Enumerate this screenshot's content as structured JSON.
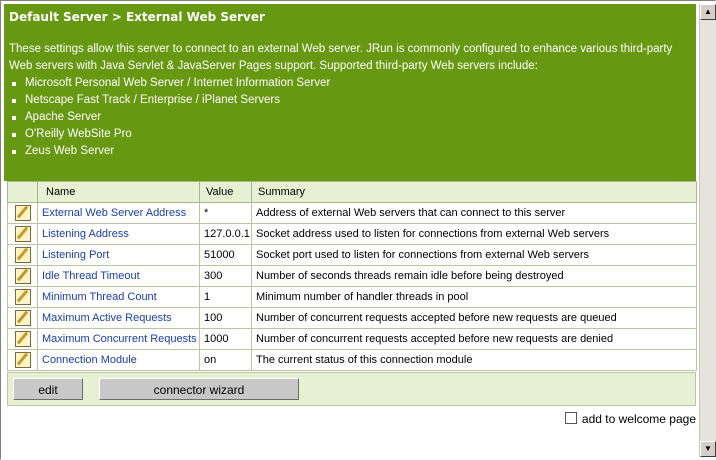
{
  "breadcrumb": "Default Server > External Web Server",
  "intro": "These settings allow this server to connect to an external Web server. JRun is commonly configured to enhance various third-party Web servers with Java Servlet & JavaServer Pages support. Supported third-party Web servers include:",
  "servers": [
    "Microsoft Personal Web Server / Internet Information Server",
    "Netscape Fast Track / Enterprise / iPlanet Servers",
    "Apache Server",
    "O'Reilly WebSite Pro",
    "Zeus Web Server"
  ],
  "columns": {
    "name": "Name",
    "value": "Value",
    "summary": "Summary"
  },
  "rows": [
    {
      "name": "External Web Server Address",
      "value": "*",
      "summary": "Address of external Web servers that can connect to this server"
    },
    {
      "name": "Listening Address",
      "value": "127.0.0.1",
      "summary": "Socket address used to listen for connections from external Web servers"
    },
    {
      "name": "Listening Port",
      "value": "51000",
      "summary": "Socket port used to listen for connections from external Web servers"
    },
    {
      "name": "Idle Thread Timeout",
      "value": "300",
      "summary": "Number of seconds threads remain idle before being destroyed"
    },
    {
      "name": "Minimum Thread Count",
      "value": "1",
      "summary": "Minimum number of handler threads in pool"
    },
    {
      "name": "Maximum Active Requests",
      "value": "100",
      "summary": "Number of concurrent requests accepted before new requests are queued"
    },
    {
      "name": "Maximum Concurrent Requests",
      "value": "1000",
      "summary": "Number of concurrent requests accepted before new requests are denied"
    },
    {
      "name": "Connection Module",
      "value": "on",
      "summary": "The current status of this connection module"
    }
  ],
  "buttons": {
    "edit": "edit",
    "wizard": "connector wizard"
  },
  "welcome_label": "add to welcome page",
  "colors": {
    "header_bg": "#669911",
    "table_header_bg": "#e8f0d4",
    "link": "#1a3fa6"
  },
  "icons": {
    "row_icon": "edit-pencil-icon",
    "scroll_up": "scroll-up-icon",
    "scroll_down": "scroll-down-icon"
  }
}
